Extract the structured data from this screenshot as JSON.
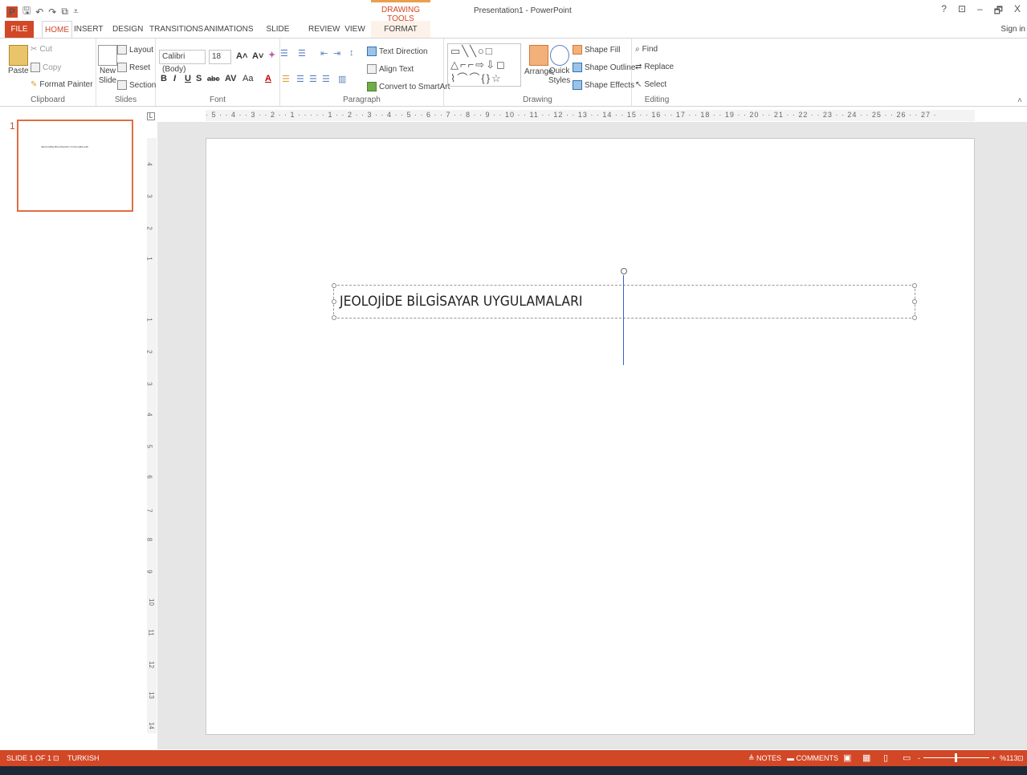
{
  "title_bar": {
    "window_title": "Presentation1 - PowerPoint",
    "contextual_label": "DRAWING TOOLS",
    "controls": [
      "?",
      "⊡",
      "–",
      "🗗",
      "X"
    ]
  },
  "tabs": {
    "file": "FILE",
    "home": "HOME",
    "insert": "INSERT",
    "design": "DESIGN",
    "transitions": "TRANSITIONS",
    "animations": "ANIMATIONS",
    "slideshow": "SLIDE SHOW",
    "review": "REVIEW",
    "view": "VIEW",
    "format": "FORMAT",
    "signin": "Sign in"
  },
  "ribbon": {
    "clipboard": {
      "paste": "Paste",
      "cut": "Cut",
      "copy": "Copy",
      "format_painter": "Format Painter",
      "label": "Clipboard"
    },
    "slides": {
      "new_slide_1": "New",
      "new_slide_2": "Slide",
      "layout": "Layout",
      "reset": "Reset",
      "section": "Section",
      "label": "Slides"
    },
    "font": {
      "family": "Calibri (Body)",
      "size": "18",
      "label": "Font"
    },
    "paragraph": {
      "text_direction": "Text Direction",
      "align_text": "Align Text",
      "convert_smartart": "Convert to SmartArt",
      "label": "Paragraph"
    },
    "drawing": {
      "arrange": "Arrange",
      "quick_1": "Quick",
      "quick_2": "Styles",
      "shape_fill": "Shape Fill",
      "shape_outline": "Shape Outline",
      "shape_effects": "Shape Effects",
      "label": "Drawing"
    },
    "editing": {
      "find": "Find",
      "replace": "Replace",
      "select": "Select",
      "label": "Editing"
    }
  },
  "thumbnails": {
    "slide_number": "1",
    "thumb_text": "JEOLOJİDE BİLGİSAYAR UYGULAMALARI"
  },
  "ruler": {
    "horizontal": "· 5 · · 4 · · 3 · · 2 · · 1 · · · · · 1 · · 2 · · 3 · · 4 · · 5 · · 6 · · 7 · · 8 · · 9 · · 10 · · 11 · · 12 · · 13 · · 14 · · 15 · · 16 · · 17 · · 18 · · 19 · · 20 · · 21 · · 22 · · 23 · · 24 · · 25 · · 26 · · 27 ·",
    "vertical": [
      "4",
      "3",
      "2",
      "1",
      "1",
      "2",
      "3",
      "4",
      "5",
      "6",
      "7",
      "8",
      "9",
      "10",
      "11",
      "12",
      "13",
      "14"
    ]
  },
  "slide": {
    "text": "JEOLOJİDE BİLGİSAYAR UYGULAMALARI"
  },
  "status_bar": {
    "slide_info": "SLIDE 1 OF 1",
    "language": "TURKISH",
    "notes": "NOTES",
    "comments": "COMMENTS",
    "zoom": "%113"
  }
}
